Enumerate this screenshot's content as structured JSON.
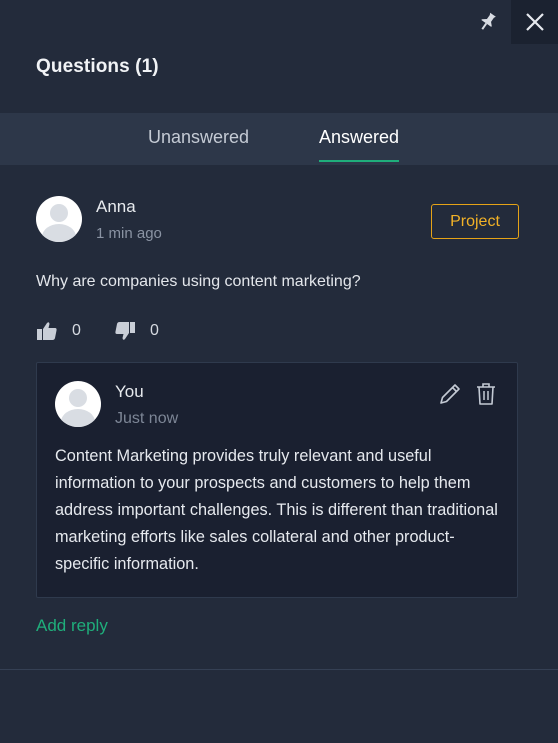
{
  "window": {
    "pin_icon": "pin-icon",
    "close_icon": "close-icon"
  },
  "panel": {
    "title": "Questions (1)"
  },
  "tabs": [
    {
      "label": "Unanswered",
      "active": false
    },
    {
      "label": "Answered",
      "active": true
    }
  ],
  "question": {
    "author": "Anna",
    "time": "1 min ago",
    "badge_label": "Project",
    "text": "Why are companies using content marketing?",
    "upvotes": "0",
    "downvotes": "0"
  },
  "reply": {
    "author": "You",
    "time": "Just now",
    "text": "Content Marketing provides truly relevant and useful information to your prospects and customers to help them address important challenges. This is different than traditional marketing efforts like sales collateral and other product-specific information."
  },
  "actions": {
    "add_reply_label": "Add reply"
  },
  "colors": {
    "background": "#232b3b",
    "tab_bar": "#2d3749",
    "reply_box": "#1a2030",
    "accent_green": "#1fae7b",
    "accent_orange": "#e5a317"
  }
}
